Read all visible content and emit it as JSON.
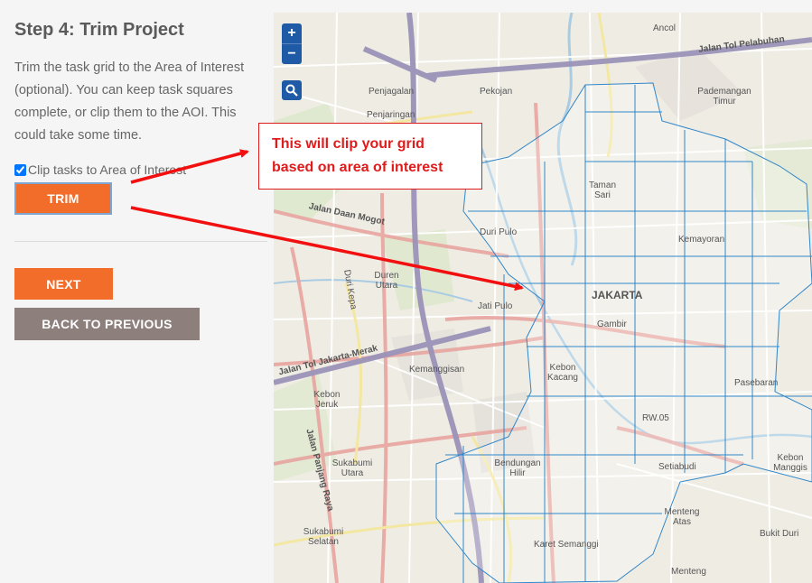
{
  "step": {
    "title": "Step 4: Trim Project",
    "description": "Trim the task grid to the Area of Interest (optional). You can keep task squares complete, or clip them to the AOI. This could take some time."
  },
  "options": {
    "clip_label": "Clip tasks to Area of Interest",
    "clip_checked": true
  },
  "buttons": {
    "trim": "TRIM",
    "next": "NEXT",
    "back": "BACK TO PREVIOUS"
  },
  "map": {
    "zoom_in": "+",
    "zoom_out": "−",
    "search_icon": "magnifier-icon",
    "labels": [
      {
        "text": "Jalan Tol Pelabuhan"
      },
      {
        "text": "Ancol"
      },
      {
        "text": "Pademangan Timur"
      },
      {
        "text": "Penjagalan"
      },
      {
        "text": "Pekojan"
      },
      {
        "text": "Penjaringan"
      },
      {
        "text": "Taman Sari"
      },
      {
        "text": "Duri Pulo"
      },
      {
        "text": "JAKARTA"
      },
      {
        "text": "Gambir"
      },
      {
        "text": "Jalan Daan Mogot"
      },
      {
        "text": "Jati Pulo"
      },
      {
        "text": "Duren Utara"
      },
      {
        "text": "Duri Kepa"
      },
      {
        "text": "Jalan Tol Jakarta-Merak"
      },
      {
        "text": "Kemanggisan"
      },
      {
        "text": "Kebon Kacang"
      },
      {
        "text": "Kebon Jeruk"
      },
      {
        "text": "Sukabumi Utara"
      },
      {
        "text": "Bendungan Hilir"
      },
      {
        "text": "Setiabudi"
      },
      {
        "text": "Menteng Atas"
      },
      {
        "text": "Karet Semanggi"
      },
      {
        "text": "Sukabumi Selatan"
      },
      {
        "text": "Kebon Manggis"
      },
      {
        "text": "Bukit Duri"
      },
      {
        "text": "Kemayoran"
      },
      {
        "text": "Pasebaran"
      },
      {
        "text": "Menteng"
      },
      {
        "text": "Jalan Panjang Raya"
      },
      {
        "text": "RW.05"
      }
    ]
  },
  "annotation": {
    "line1": "This will clip your grid",
    "line2": "based on area of interest"
  },
  "colors": {
    "accent": "#f26d2a",
    "back": "#8c7f7c",
    "callout": "#e01b1b",
    "grid": "#2f86c9",
    "zoom": "#1f5aa6"
  }
}
